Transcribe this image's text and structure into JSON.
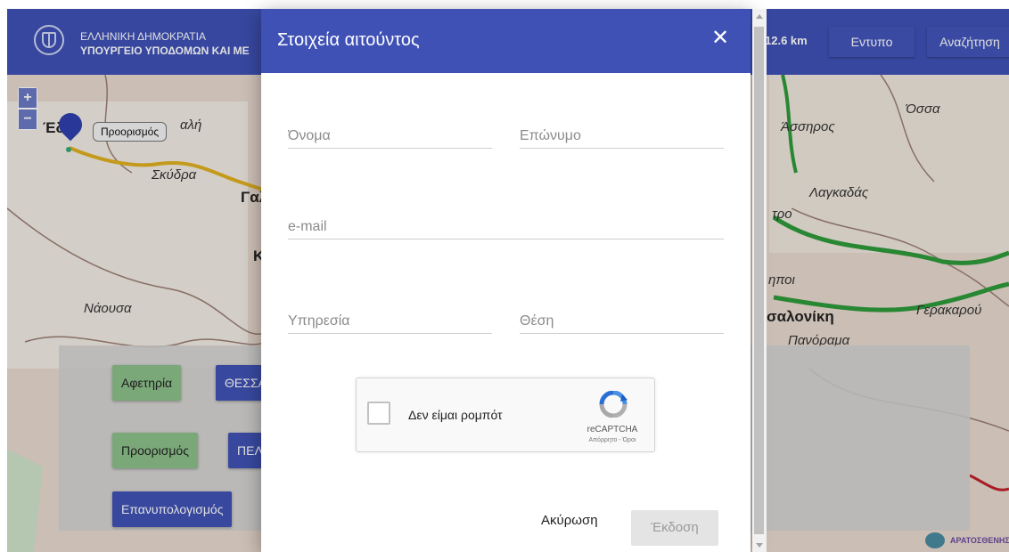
{
  "header": {
    "org_line1": "ΕΛΛΗΝΙΚΗ ΔΗΜΟΚΡΑΤΙΑ",
    "org_line2": "ΥΠΟΥΡΓΕΙΟ ΥΠΟΔΟΜΩΝ ΚΑΙ ΜΕ",
    "distance": "12.6 km",
    "print_button": "Εντυπο",
    "search_button": "Αναζήτηση"
  },
  "map": {
    "zoom_in": "+",
    "zoom_out": "−",
    "marker_tooltip": "Προορισμός",
    "labels": {
      "edessa": "Έδ",
      "veroia_partial": "αλή",
      "skydra": "Σκύδρα",
      "gal": "Γαλ",
      "k": "Κ",
      "naousa": "Νάουσα",
      "asiros": "Άσσηρος",
      "ossa": "Όσσα",
      "lagkadas": "Λαγκαδάς",
      "tro": "τρο",
      "ipoi": "ηποι",
      "thessaloniki": "σαλονίκη",
      "gerakarou": "Γερακαρού",
      "panorama": "Πανόραμα"
    },
    "panel": {
      "start_button": "Αφετηρία",
      "start_value": "ΘΕΣΣΑ",
      "destination_button": "Προορισμός",
      "destination_value": "ΠΕΛ",
      "recalc_button": "Επανυπολογισμός"
    },
    "watermark": "ΑΡΑΤΟΣΘΕΝΗΣ"
  },
  "modal": {
    "title": "Στοιχεία αιτούντος",
    "close_glyph": "✕",
    "fields": {
      "first_name_placeholder": "Όνομα",
      "last_name_placeholder": "Επώνυμο",
      "email_placeholder": "e-mail",
      "service_placeholder": "Υπηρεσία",
      "position_placeholder": "Θέση"
    },
    "captcha": {
      "label": "Δεν είμαι ρομπότ",
      "brand": "reCAPTCHA",
      "terms": "Απόρρητο - Όροι"
    },
    "cancel_button": "Ακύρωση",
    "issue_button": "Έκδοση"
  },
  "colors": {
    "primary": "#3f51b5",
    "green_button": "#8cc08a",
    "map_bg": "#e7d9cf",
    "route": "#e0b020",
    "road_green": "#2e9a3a"
  },
  "icons": {
    "close": "close-icon",
    "marker": "map-marker-icon",
    "captcha_logo": "recaptcha-logo-icon",
    "emblem": "greek-emblem-icon"
  }
}
